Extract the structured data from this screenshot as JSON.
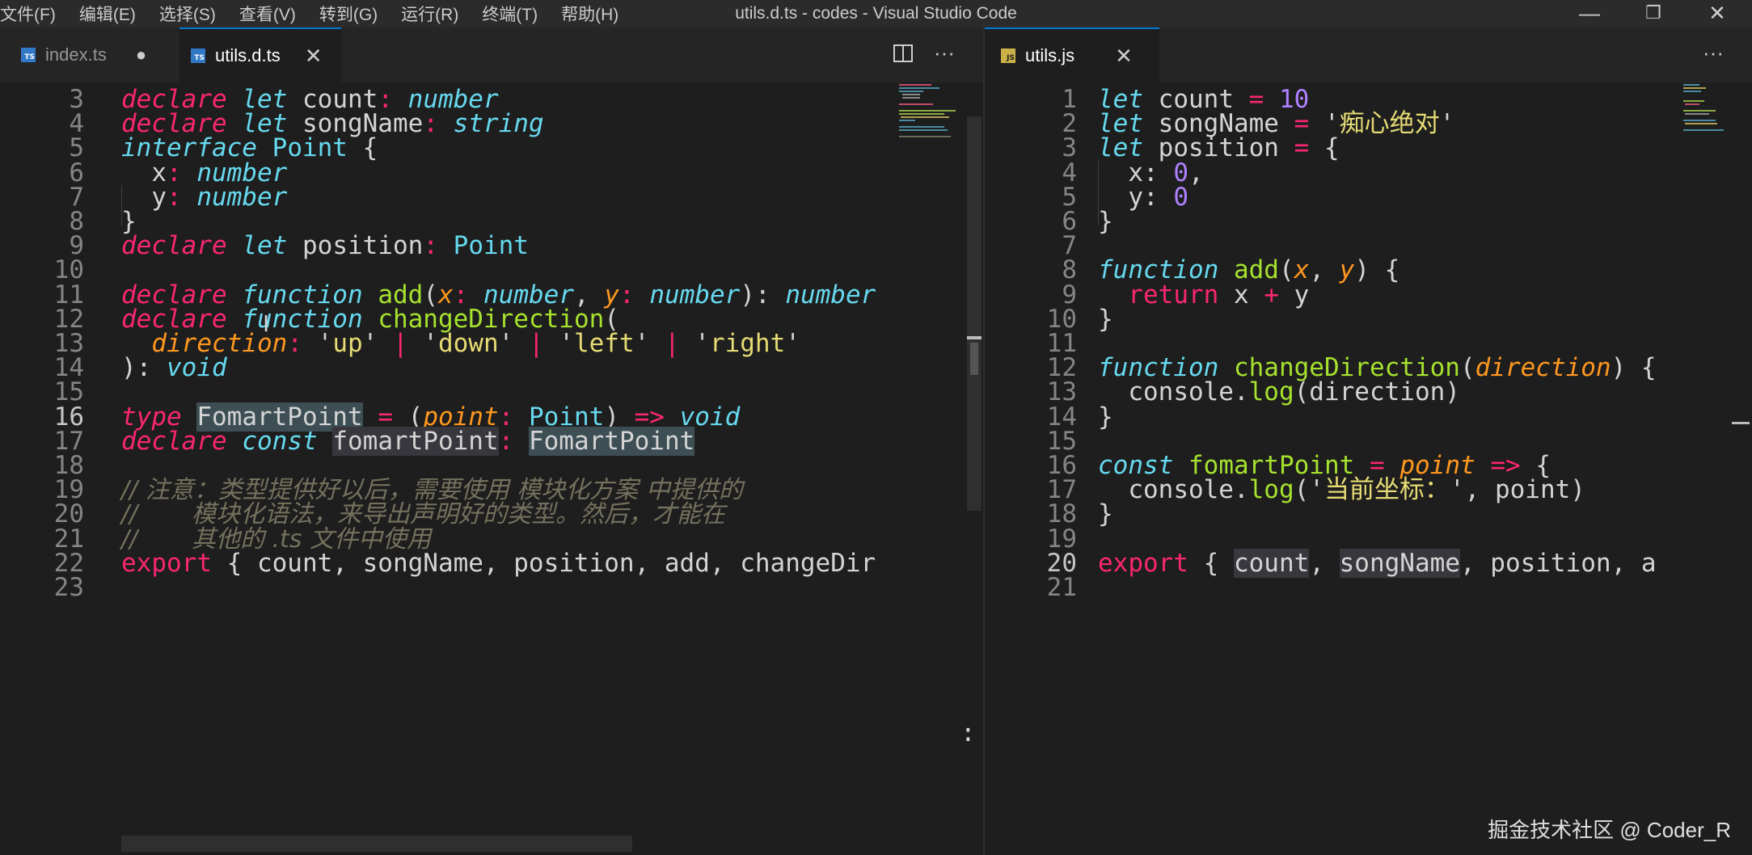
{
  "window": {
    "menu": [
      "文件(F)",
      "编辑(E)",
      "选择(S)",
      "查看(V)",
      "转到(G)",
      "运行(R)",
      "终端(T)",
      "帮助(H)"
    ],
    "title": "utils.d.ts - codes - Visual Studio Code",
    "minimize": "—",
    "restore": "❐",
    "close": "✕"
  },
  "left_pane": {
    "tabs": [
      {
        "label": "index.ts",
        "icon": "ts-file-icon",
        "status": "●"
      },
      {
        "label": "utils.d.ts",
        "icon": "ts-file-icon",
        "close": "✕"
      }
    ],
    "actions": {
      "split": "split-editor-icon",
      "more": "···"
    },
    "lines": [
      {
        "n": "3",
        "tokens": [
          [
            "kw",
            "declare"
          ],
          [
            "pu",
            " "
          ],
          [
            "kb",
            "let"
          ],
          [
            "pu",
            " count"
          ],
          [
            "op",
            ":"
          ],
          [
            "pu",
            " "
          ],
          [
            "ty",
            "number"
          ]
        ]
      },
      {
        "n": "4",
        "tokens": [
          [
            "kw",
            "declare"
          ],
          [
            "pu",
            " "
          ],
          [
            "kb",
            "let"
          ],
          [
            "pu",
            " songName"
          ],
          [
            "op",
            ":"
          ],
          [
            "pu",
            " "
          ],
          [
            "ty",
            "string"
          ]
        ]
      },
      {
        "n": "5",
        "tokens": [
          [
            "kb",
            "interface"
          ],
          [
            "pu",
            " "
          ],
          [
            "cn",
            "Point"
          ],
          [
            "pu",
            " {"
          ]
        ]
      },
      {
        "n": "6",
        "tokens": [
          [
            "pu",
            "  x"
          ],
          [
            "op",
            ":"
          ],
          [
            "pu",
            " "
          ],
          [
            "ty",
            "number"
          ]
        ]
      },
      {
        "n": "7",
        "tokens": [
          [
            "pu",
            "  y"
          ],
          [
            "op",
            ":"
          ],
          [
            "pu",
            " "
          ],
          [
            "ty",
            "number"
          ]
        ]
      },
      {
        "n": "8",
        "tokens": [
          [
            "pu",
            "}"
          ]
        ]
      },
      {
        "n": "9",
        "tokens": [
          [
            "kw",
            "declare"
          ],
          [
            "pu",
            " "
          ],
          [
            "kb",
            "let"
          ],
          [
            "pu",
            " position"
          ],
          [
            "op",
            ":"
          ],
          [
            "pu",
            " "
          ],
          [
            "cn",
            "Point"
          ]
        ]
      },
      {
        "n": "10",
        "tokens": []
      },
      {
        "n": "11",
        "tokens": [
          [
            "kw",
            "declare"
          ],
          [
            "pu",
            " "
          ],
          [
            "kb",
            "function"
          ],
          [
            "pu",
            " "
          ],
          [
            "fn",
            "add"
          ],
          [
            "pu",
            "("
          ],
          [
            "pa",
            "x"
          ],
          [
            "op",
            ":"
          ],
          [
            "pu",
            " "
          ],
          [
            "ty",
            "number"
          ],
          [
            "pu",
            ", "
          ],
          [
            "pa",
            "y"
          ],
          [
            "op",
            ":"
          ],
          [
            "pu",
            " "
          ],
          [
            "ty",
            "number"
          ],
          [
            "pu",
            "): "
          ],
          [
            "ty",
            "number"
          ]
        ]
      },
      {
        "n": "12",
        "tokens": [
          [
            "kw",
            "declare"
          ],
          [
            "pu",
            " "
          ],
          [
            "kb",
            "function"
          ],
          [
            "pu",
            " "
          ],
          [
            "fn",
            "changeDirection"
          ],
          [
            "pu",
            "("
          ]
        ]
      },
      {
        "n": "13",
        "tokens": [
          [
            "pu",
            "  "
          ],
          [
            "pa",
            "direction"
          ],
          [
            "op",
            ":"
          ],
          [
            "pu",
            " '"
          ],
          [
            "st",
            "up"
          ],
          [
            "pu",
            "' "
          ],
          [
            "op",
            "|"
          ],
          [
            "pu",
            " '"
          ],
          [
            "st",
            "down"
          ],
          [
            "pu",
            "' "
          ],
          [
            "op",
            "|"
          ],
          [
            "pu",
            " '"
          ],
          [
            "st",
            "left"
          ],
          [
            "pu",
            "' "
          ],
          [
            "op",
            "|"
          ],
          [
            "pu",
            " '"
          ],
          [
            "st",
            "right"
          ],
          [
            "pu",
            "'"
          ]
        ]
      },
      {
        "n": "14",
        "tokens": [
          [
            "pu",
            "): "
          ],
          [
            "ty",
            "void"
          ]
        ]
      },
      {
        "n": "15",
        "tokens": []
      },
      {
        "n": "16",
        "current": true,
        "tokens": [
          [
            "kw",
            "type"
          ],
          [
            "pu",
            " "
          ],
          [
            "hl",
            "FomartPoint"
          ],
          [
            "pu",
            " "
          ],
          [
            "op",
            "="
          ],
          [
            "pu",
            " ("
          ],
          [
            "pa",
            "point"
          ],
          [
            "op",
            ":"
          ],
          [
            "pu",
            " "
          ],
          [
            "cn",
            "Point"
          ],
          [
            "pu",
            ") "
          ],
          [
            "op",
            "=>"
          ],
          [
            "pu",
            " "
          ],
          [
            "ty",
            "void"
          ]
        ]
      },
      {
        "n": "17",
        "tokens": [
          [
            "kw",
            "declare"
          ],
          [
            "pu",
            " "
          ],
          [
            "kb",
            "const"
          ],
          [
            "pu",
            " "
          ],
          [
            "wm",
            "fomartPoint"
          ],
          [
            "op",
            ":"
          ],
          [
            "pu",
            " "
          ],
          [
            "hl",
            "FomartPoint"
          ]
        ]
      },
      {
        "n": "18",
        "tokens": []
      },
      {
        "n": "19",
        "tokens": [
          [
            "cm",
            "// 注意：类型提供好以后，需要使用 模块化方案 中提供的"
          ]
        ]
      },
      {
        "n": "20",
        "tokens": [
          [
            "cm",
            "//       模块化语法，来导出声明好的类型。然后，才能在"
          ]
        ]
      },
      {
        "n": "21",
        "tokens": [
          [
            "cm",
            "//       其他的 .ts 文件中使用"
          ]
        ]
      },
      {
        "n": "22",
        "tokens": [
          [
            "op",
            "export"
          ],
          [
            "pu",
            " { count, songName, position, add, changeDir"
          ]
        ]
      },
      {
        "n": "23",
        "tokens": []
      }
    ],
    "overflow_glyph": ":"
  },
  "right_pane": {
    "tabs": [
      {
        "label": "utils.js",
        "icon": "js-file-icon",
        "close": "✕"
      }
    ],
    "actions": {
      "more": "···"
    },
    "lines": [
      {
        "n": "1",
        "tokens": [
          [
            "kb",
            "let"
          ],
          [
            "pu",
            " count "
          ],
          [
            "op",
            "="
          ],
          [
            "pu",
            " "
          ],
          [
            "nu",
            "10"
          ]
        ]
      },
      {
        "n": "2",
        "tokens": [
          [
            "kb",
            "let"
          ],
          [
            "pu",
            " songName "
          ],
          [
            "op",
            "="
          ],
          [
            "pu",
            " '"
          ],
          [
            "st",
            "痴心绝对"
          ],
          [
            "pu",
            "'"
          ]
        ]
      },
      {
        "n": "3",
        "tokens": [
          [
            "kb",
            "let"
          ],
          [
            "pu",
            " position "
          ],
          [
            "op",
            "="
          ],
          [
            "pu",
            " {"
          ]
        ]
      },
      {
        "n": "4",
        "tokens": [
          [
            "pu",
            "  x: "
          ],
          [
            "nu",
            "0"
          ],
          [
            "pu",
            ","
          ]
        ]
      },
      {
        "n": "5",
        "tokens": [
          [
            "pu",
            "  y: "
          ],
          [
            "nu",
            "0"
          ]
        ]
      },
      {
        "n": "6",
        "tokens": [
          [
            "pu",
            "}"
          ]
        ]
      },
      {
        "n": "7",
        "tokens": []
      },
      {
        "n": "8",
        "tokens": [
          [
            "kb",
            "function"
          ],
          [
            "pu",
            " "
          ],
          [
            "fn",
            "add"
          ],
          [
            "pu",
            "("
          ],
          [
            "pa",
            "x"
          ],
          [
            "pu",
            ", "
          ],
          [
            "pa",
            "y"
          ],
          [
            "pu",
            ") {"
          ]
        ]
      },
      {
        "n": "9",
        "tokens": [
          [
            "pu",
            "  "
          ],
          [
            "op",
            "return"
          ],
          [
            "pu",
            " x "
          ],
          [
            "op",
            "+"
          ],
          [
            "pu",
            " y"
          ]
        ]
      },
      {
        "n": "10",
        "tokens": [
          [
            "pu",
            "}"
          ]
        ]
      },
      {
        "n": "11",
        "tokens": []
      },
      {
        "n": "12",
        "tokens": [
          [
            "kb",
            "function"
          ],
          [
            "pu",
            " "
          ],
          [
            "fn",
            "changeDirection"
          ],
          [
            "pu",
            "("
          ],
          [
            "pa",
            "direction"
          ],
          [
            "pu",
            ") {"
          ]
        ]
      },
      {
        "n": "13",
        "tokens": [
          [
            "pu",
            "  console."
          ],
          [
            "fn",
            "log"
          ],
          [
            "pu",
            "(direction)"
          ]
        ]
      },
      {
        "n": "14",
        "tokens": [
          [
            "pu",
            "}"
          ]
        ]
      },
      {
        "n": "15",
        "tokens": []
      },
      {
        "n": "16",
        "tokens": [
          [
            "kb",
            "const"
          ],
          [
            "pu",
            " "
          ],
          [
            "fn",
            "fomartPoint"
          ],
          [
            "pu",
            " "
          ],
          [
            "op",
            "="
          ],
          [
            "pu",
            " "
          ],
          [
            "pa",
            "point"
          ],
          [
            "pu",
            " "
          ],
          [
            "op",
            "=>"
          ],
          [
            "pu",
            " {"
          ]
        ]
      },
      {
        "n": "17",
        "tokens": [
          [
            "pu",
            "  console."
          ],
          [
            "fn",
            "log"
          ],
          [
            "pu",
            "('"
          ],
          [
            "st",
            "当前坐标："
          ],
          [
            "pu",
            "', point)"
          ]
        ]
      },
      {
        "n": "18",
        "tokens": [
          [
            "pu",
            "}"
          ]
        ]
      },
      {
        "n": "19",
        "tokens": []
      },
      {
        "n": "20",
        "current": true,
        "tokens": [
          [
            "op",
            "export"
          ],
          [
            "pu",
            " { "
          ],
          [
            "wm",
            "count"
          ],
          [
            "pu",
            ", "
          ],
          [
            "wm",
            "songName"
          ],
          [
            "pu",
            ", position, a"
          ]
        ]
      },
      {
        "n": "21",
        "tokens": []
      }
    ]
  },
  "watermark": "掘金技术社区 @ Coder_R"
}
